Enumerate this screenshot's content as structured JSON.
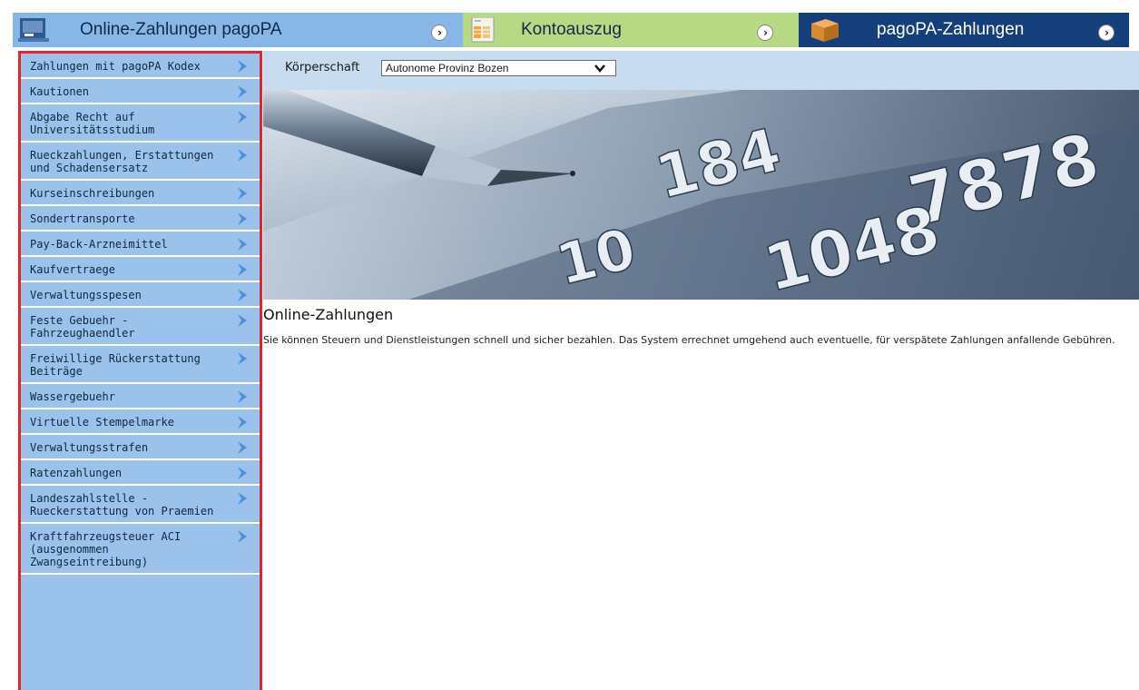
{
  "tabs": [
    {
      "label": "Online-Zahlungen pagoPA",
      "icon": "computer-icon"
    },
    {
      "label": "Kontoauszug",
      "icon": "document-icon"
    },
    {
      "label": "pagoPA-Zahlungen",
      "icon": "box-icon"
    }
  ],
  "sidebar": {
    "items": [
      {
        "label": "Zahlungen mit pagoPA Kodex"
      },
      {
        "label": "Kautionen"
      },
      {
        "label": "Abgabe Recht auf Universitätsstudium"
      },
      {
        "label": "Rueckzahlungen, Erstattungen und Schadensersatz"
      },
      {
        "label": "Kurseinschreibungen"
      },
      {
        "label": "Sondertransporte"
      },
      {
        "label": "Pay-Back-Arzneimittel"
      },
      {
        "label": "Kaufvertraege"
      },
      {
        "label": "Verwaltungsspesen"
      },
      {
        "label": "Feste Gebuehr - Fahrzeughaendler"
      },
      {
        "label": "Freiwillige Rückerstattung Beiträge"
      },
      {
        "label": "Wassergebuehr"
      },
      {
        "label": "Virtuelle Stempelmarke"
      },
      {
        "label": "Verwaltungsstrafen"
      },
      {
        "label": "Ratenzahlungen"
      },
      {
        "label": "Landeszahlstelle - Rueckerstattung von Praemien"
      },
      {
        "label": "Kraftfahrzeugsteuer ACI (ausgenommen Zwangseintreibung)"
      }
    ]
  },
  "entity": {
    "label": "Körperschaft",
    "selected": "Autonome Provinz Bozen"
  },
  "banner": {
    "card_numbers": [
      "184",
      "7878",
      "1048",
      "10"
    ]
  },
  "content": {
    "title": "Online-Zahlungen",
    "text": "Sie können Steuern und Dienstleistungen schnell und sicher bezahlen. Das System errechnet umgehend auch eventuelle, für verspätete Zahlungen anfallende Gebühren."
  },
  "colors": {
    "tab1": "#86b7e6",
    "tab2": "#b8d984",
    "tab3": "#143f7a",
    "sidebar": "#9ac2ea",
    "highlight_border": "#e0252f",
    "toolbar": "#c7dcee"
  }
}
